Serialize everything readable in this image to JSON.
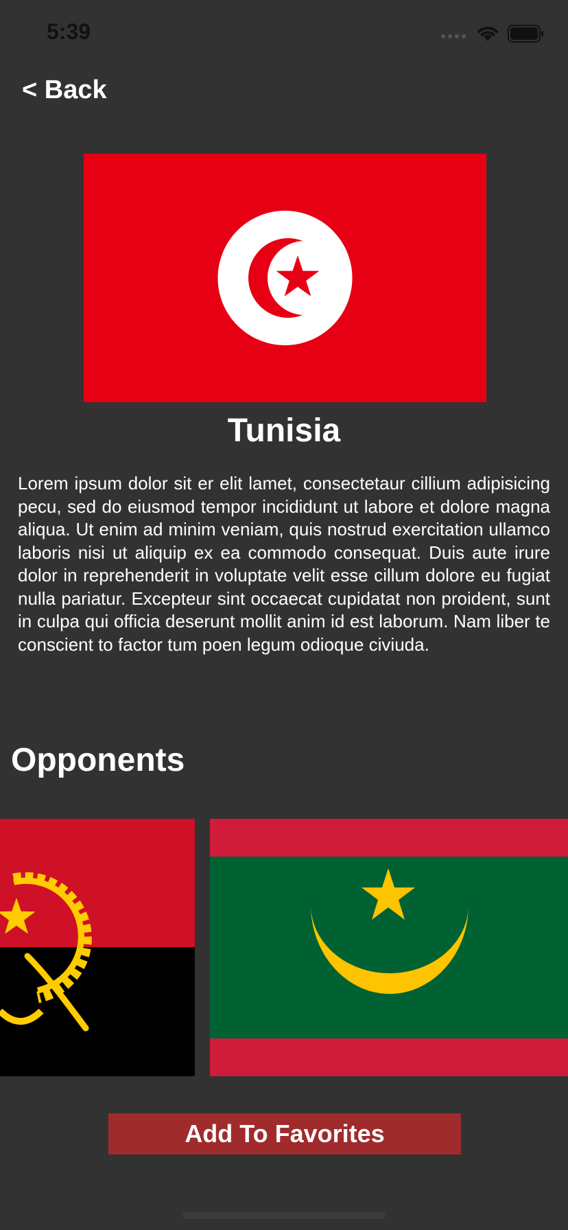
{
  "status_bar": {
    "time": "5:39",
    "icons": [
      "cellular-signal-icon",
      "wifi-icon",
      "battery-icon"
    ]
  },
  "nav": {
    "back_label": "< Back"
  },
  "country": {
    "name": "Tunisia",
    "flag": "tunisia-flag",
    "description": "Lorem ipsum dolor sit er elit lamet, consectetaur cillium adipisicing pecu, sed do eiusmod tempor incididunt ut labore et dolore magna aliqua. Ut enim ad minim veniam, quis nostrud exercitation ullamco laboris nisi ut aliquip ex ea commodo consequat. Duis aute irure dolor in reprehenderit in voluptate velit esse cillum dolore eu fugiat nulla pariatur. Excepteur sint occaecat cupidatat non proident, sunt in culpa qui officia deserunt mollit anim id est laborum. Nam liber te conscient to factor tum poen legum odioque civiuda."
  },
  "opponents": {
    "title": "Opponents",
    "flags": [
      "angola-flag",
      "mauritania-flag"
    ]
  },
  "actions": {
    "favorites_label": "Add To Favorites"
  },
  "colors": {
    "background": "#323232",
    "tunisia_red": "#e70013",
    "angola_red": "#ce1126",
    "mauritania_green": "#006233",
    "mauritania_red": "#d01c3a",
    "emblem_yellow": "#ffcc00",
    "button": "#a02b2c"
  }
}
